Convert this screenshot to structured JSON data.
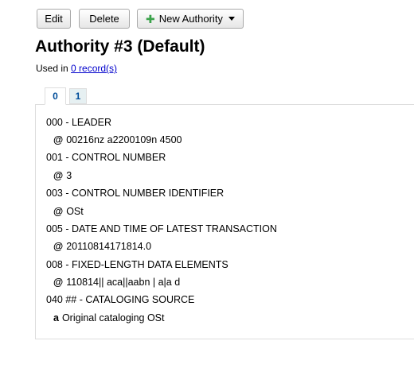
{
  "toolbar": {
    "edit_label": "Edit",
    "delete_label": "Delete",
    "new_authority_label": "New Authority"
  },
  "page": {
    "title": "Authority #3 (Default)",
    "used_in_prefix": "Used in",
    "used_in_link": "0 record(s)"
  },
  "tabs": [
    {
      "label": "0",
      "active": true
    },
    {
      "label": "1",
      "active": false
    }
  ],
  "fields": [
    {
      "tag": "000 - LEADER",
      "code": "@",
      "value": "00216nz a2200109n 4500"
    },
    {
      "tag": "001 - CONTROL NUMBER",
      "code": "@",
      "value": "3"
    },
    {
      "tag": "003 - CONTROL NUMBER IDENTIFIER",
      "code": "@",
      "value": "OSt"
    },
    {
      "tag": "005 - DATE AND TIME OF LATEST TRANSACTION",
      "code": "@",
      "value": "20110814171814.0"
    },
    {
      "tag": "008 - FIXED-LENGTH DATA ELEMENTS",
      "code": "@",
      "value": "110814|| aca||aabn | a|a d"
    },
    {
      "tag": "040 ## - CATALOGING SOURCE",
      "code": "a",
      "value": "Original cataloging OSt"
    }
  ]
}
